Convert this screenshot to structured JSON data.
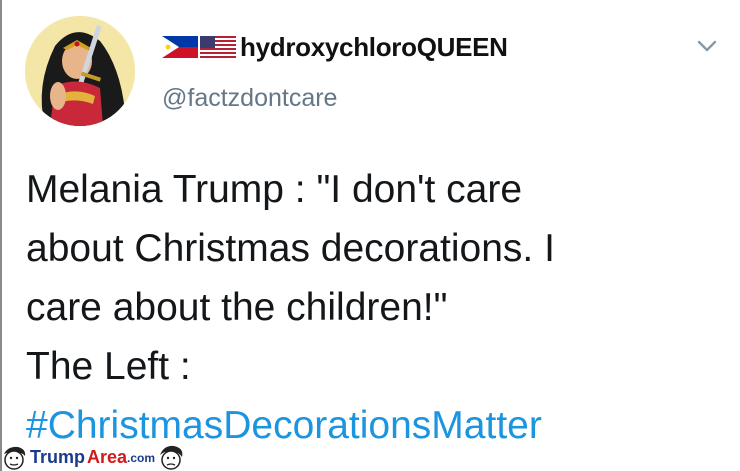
{
  "tweet": {
    "display_name": "hydroxychloroQUEEN",
    "handle": "@factzdontcare",
    "flags": [
      "philippines-flag",
      "usa-flag"
    ],
    "text_lines": [
      "Melania Trump : \"I don't care",
      "about Christmas decorations. I",
      "care about the children!\"",
      "The Left :"
    ],
    "hashtag": "#ChristmasDecorationsMatter",
    "colors": {
      "hashtag": "#1b95e0",
      "handle": "#657786",
      "text": "#14171a"
    }
  },
  "watermark": {
    "part1": "Trump",
    "part2": "Area",
    "part3": ".com"
  }
}
